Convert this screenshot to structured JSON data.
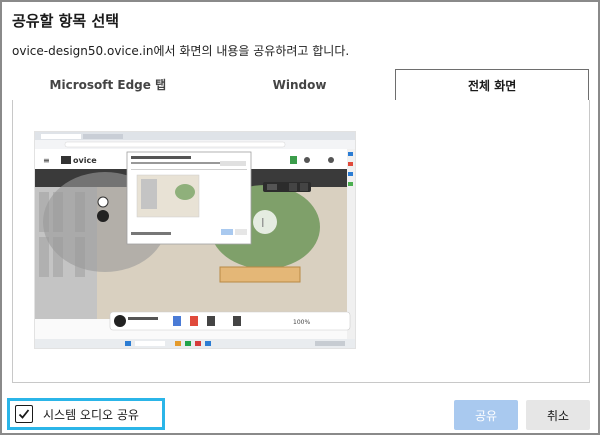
{
  "dialog": {
    "title": "공유할 항목 선택",
    "subtitle": "ovice-design50.ovice.in에서 화면의 내용을 공유하려고 합니다."
  },
  "tabs": [
    {
      "label": "Microsoft Edge 탭",
      "active": false
    },
    {
      "label": "Window",
      "active": false
    },
    {
      "label": "전체 화면",
      "active": true
    }
  ],
  "preview": {
    "brand": "ovice",
    "zoom": "100%",
    "user_label": "I"
  },
  "footer": {
    "audio_label": "시스템 오디오 공유",
    "audio_checked": true,
    "share_label": "공유",
    "cancel_label": "취소"
  },
  "colors": {
    "accent_border": "#2bb5e8",
    "share_disabled": "#a9c9ef"
  }
}
